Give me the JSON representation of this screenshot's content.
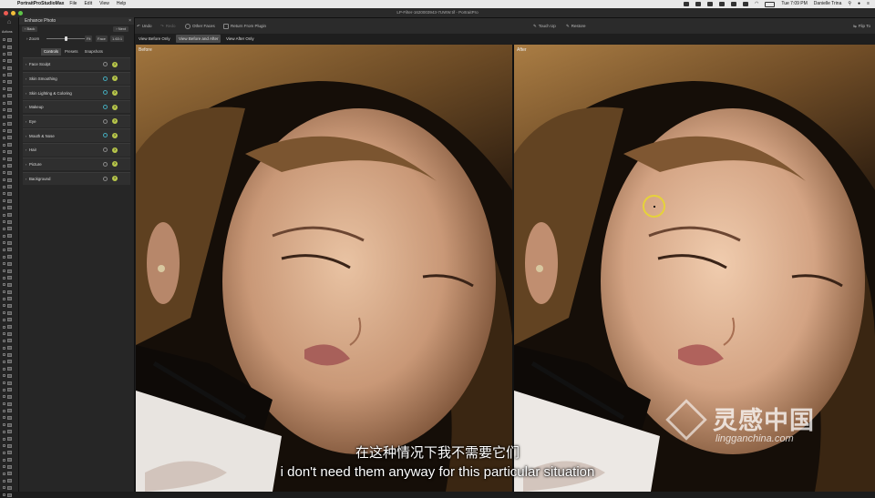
{
  "menubar": {
    "app_name": "PortraitProStudioMax",
    "items": [
      "File",
      "Edit",
      "View",
      "Help"
    ],
    "clock": "Tue 7:09 PM",
    "user": "Danielle Trina"
  },
  "window": {
    "title": "LP-Filter-1620003943-7UWW.tif - PortraitPro"
  },
  "toolbar": {
    "undo": "Undo",
    "redo": "Redo",
    "other_faces": "Other Faces",
    "return_plugin": "Return From Plugin",
    "touch_up": "Touch Up",
    "restore": "Restore",
    "flip_to": "Flip To"
  },
  "view_tabs": [
    "View Before Only",
    "View Before and After",
    "View After Only"
  ],
  "view_tabs_active": 1,
  "left_strip": {
    "actions_label": "Actions"
  },
  "panel": {
    "title": "Enhance Photo",
    "back": "Back",
    "next": "Next",
    "zoom_label": "Zoom",
    "zoom_fit": "Fit",
    "zoom_face": "Face",
    "zoom_value": "1.63:1",
    "tabs": [
      "Controls",
      "Presets",
      "Snapshots"
    ],
    "active_tab": 0,
    "sections": [
      {
        "label": "Face Sculpt",
        "active": false
      },
      {
        "label": "Skin Smoothing",
        "active": true
      },
      {
        "label": "Skin Lighting & Coloring",
        "active": true
      },
      {
        "label": "Makeup",
        "active": true
      },
      {
        "label": "Eye",
        "active": false
      },
      {
        "label": "Mouth & Nose",
        "active": true
      },
      {
        "label": "Hair",
        "active": false
      },
      {
        "label": "Picture",
        "active": false
      },
      {
        "label": "Background",
        "active": false
      }
    ]
  },
  "panes": {
    "before_label": "Before",
    "after_label": "After"
  },
  "subtitles": {
    "chinese": "在这种情况下我不需要它们",
    "english": "i don't need them anyway for this particular situation"
  },
  "watermark": {
    "brand": "灵感中国",
    "url": "lingganchina.com"
  },
  "colors": {
    "accent_yellow": "#e6d23a",
    "help_badge": "#b7c64a"
  }
}
